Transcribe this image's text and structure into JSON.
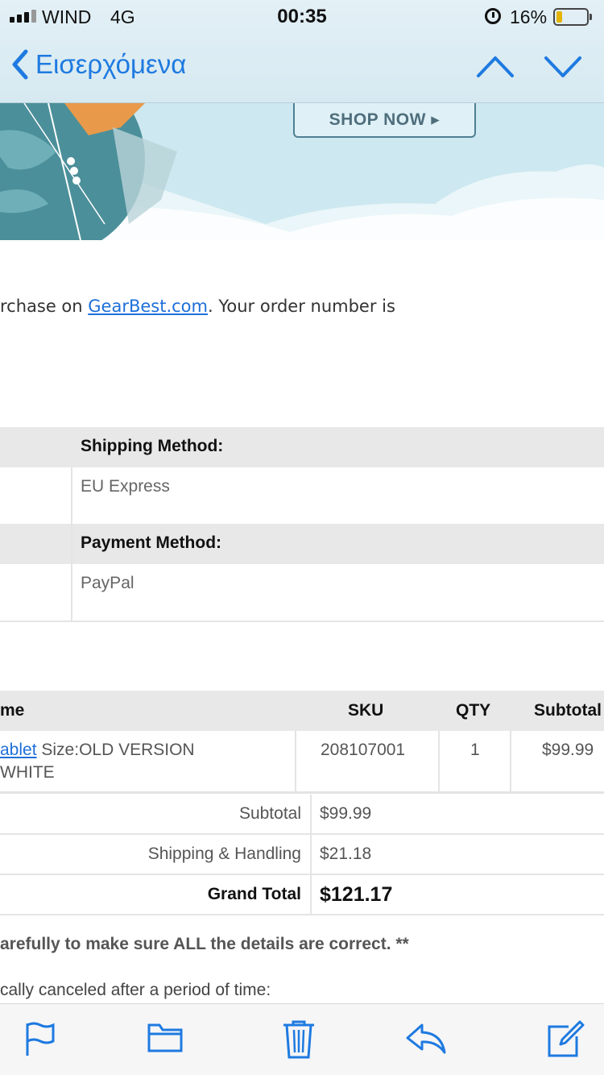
{
  "status_bar": {
    "carrier": "WIND",
    "network": "4G",
    "time": "00:35",
    "battery": "16%"
  },
  "nav": {
    "back_label": "Εισερχόμενα"
  },
  "banner": {
    "button_label": "SHOP NOW ▸"
  },
  "intro": {
    "text_before": "rchase on ",
    "link": "GearBest.com",
    "text_after": ". Your order number is"
  },
  "shipping": {
    "heading": "Shipping Method:",
    "value": "EU Express"
  },
  "payment": {
    "heading": "Payment Method:",
    "value": "PayPal"
  },
  "items_table": {
    "headers": {
      "name": "me",
      "sku": "SKU",
      "qty": "QTY",
      "subtotal": "Subtotal"
    },
    "rows": [
      {
        "name_link": "ablet",
        "name_rest": " Size:OLD VERSION",
        "name_line2": "WHITE",
        "sku": "208107001",
        "qty": "1",
        "subtotal": "$99.99"
      }
    ]
  },
  "totals": {
    "subtotal_label": "Subtotal",
    "subtotal_value": "$99.99",
    "shipping_label": "Shipping & Handling",
    "shipping_value": "$21.18",
    "grand_label": "Grand Total",
    "grand_value": "$121.17"
  },
  "notes": {
    "line1": "arefully to make sure ALL the details are correct. **",
    "line2": "cally canceled after a period of time:"
  },
  "toolbar": {
    "icons": [
      "flag-icon",
      "folder-icon",
      "trash-icon",
      "reply-icon",
      "compose-icon"
    ]
  },
  "colors": {
    "accent": "#1e7ae0",
    "link": "#1e6fd9",
    "battery": "#e3b400"
  }
}
